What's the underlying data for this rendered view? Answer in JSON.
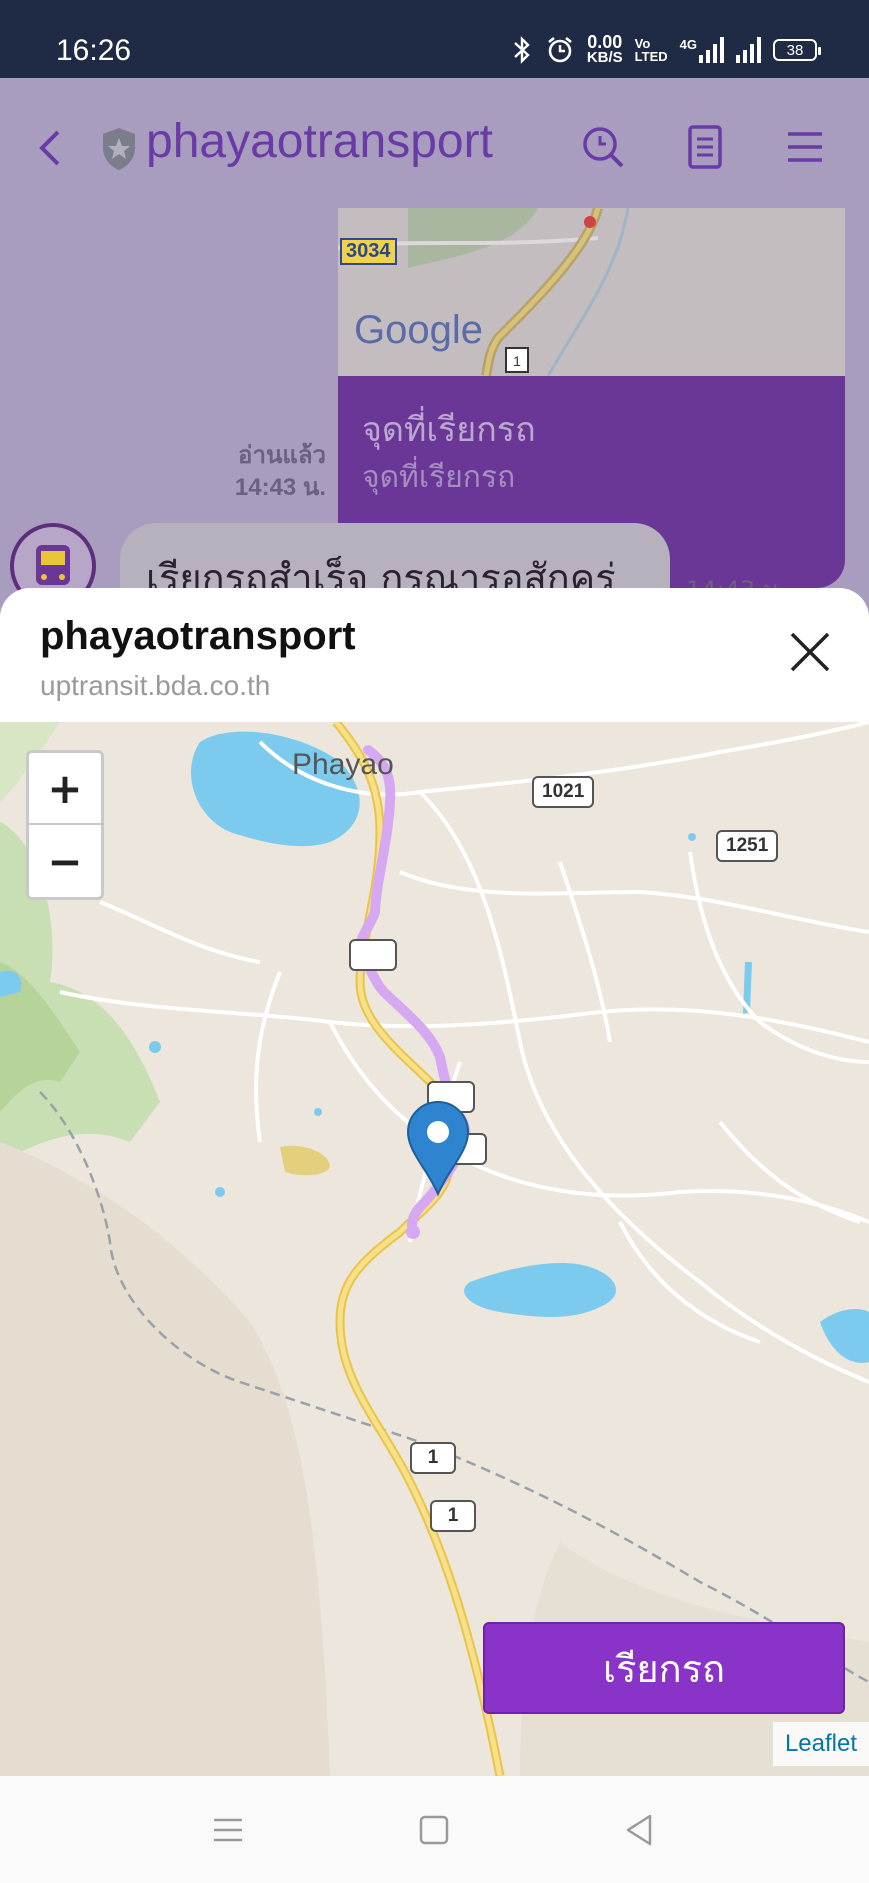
{
  "status_bar": {
    "time": "16:26",
    "net_speed_value": "0.00",
    "net_speed_unit": "KB/S",
    "volte_top": "Vo",
    "volte_bottom": "LTED",
    "network_type": "4G",
    "battery": "38"
  },
  "chat": {
    "title": "phayaotransport",
    "map_card": {
      "map_provider": "Google",
      "road_label": "3034",
      "title": "จุดที่เรียกรถ",
      "subtitle": "จุดที่เรียกรถ"
    },
    "read_label": "อ่านแล้ว",
    "read_time": "14:43 น.",
    "bot_message": "เรียกรถสำเร็จ กรุณารอสักครู่",
    "bot_message_time": "14:43 น."
  },
  "sheet": {
    "title": "phayaotransport",
    "url": "uptransit.bda.co.th",
    "map": {
      "place_label": "Phayao",
      "road_labels": {
        "r1021": "1021",
        "r1251": "1251",
        "r1a": "1",
        "r1b": "1"
      },
      "zoom_in": "+",
      "zoom_out": "−",
      "attribution": "Leaflet"
    },
    "call_button": "เรียกรถ"
  },
  "colors": {
    "brand_purple": "#8a33c9",
    "route": "#d7a8f2",
    "marker": "#2f84cf"
  }
}
